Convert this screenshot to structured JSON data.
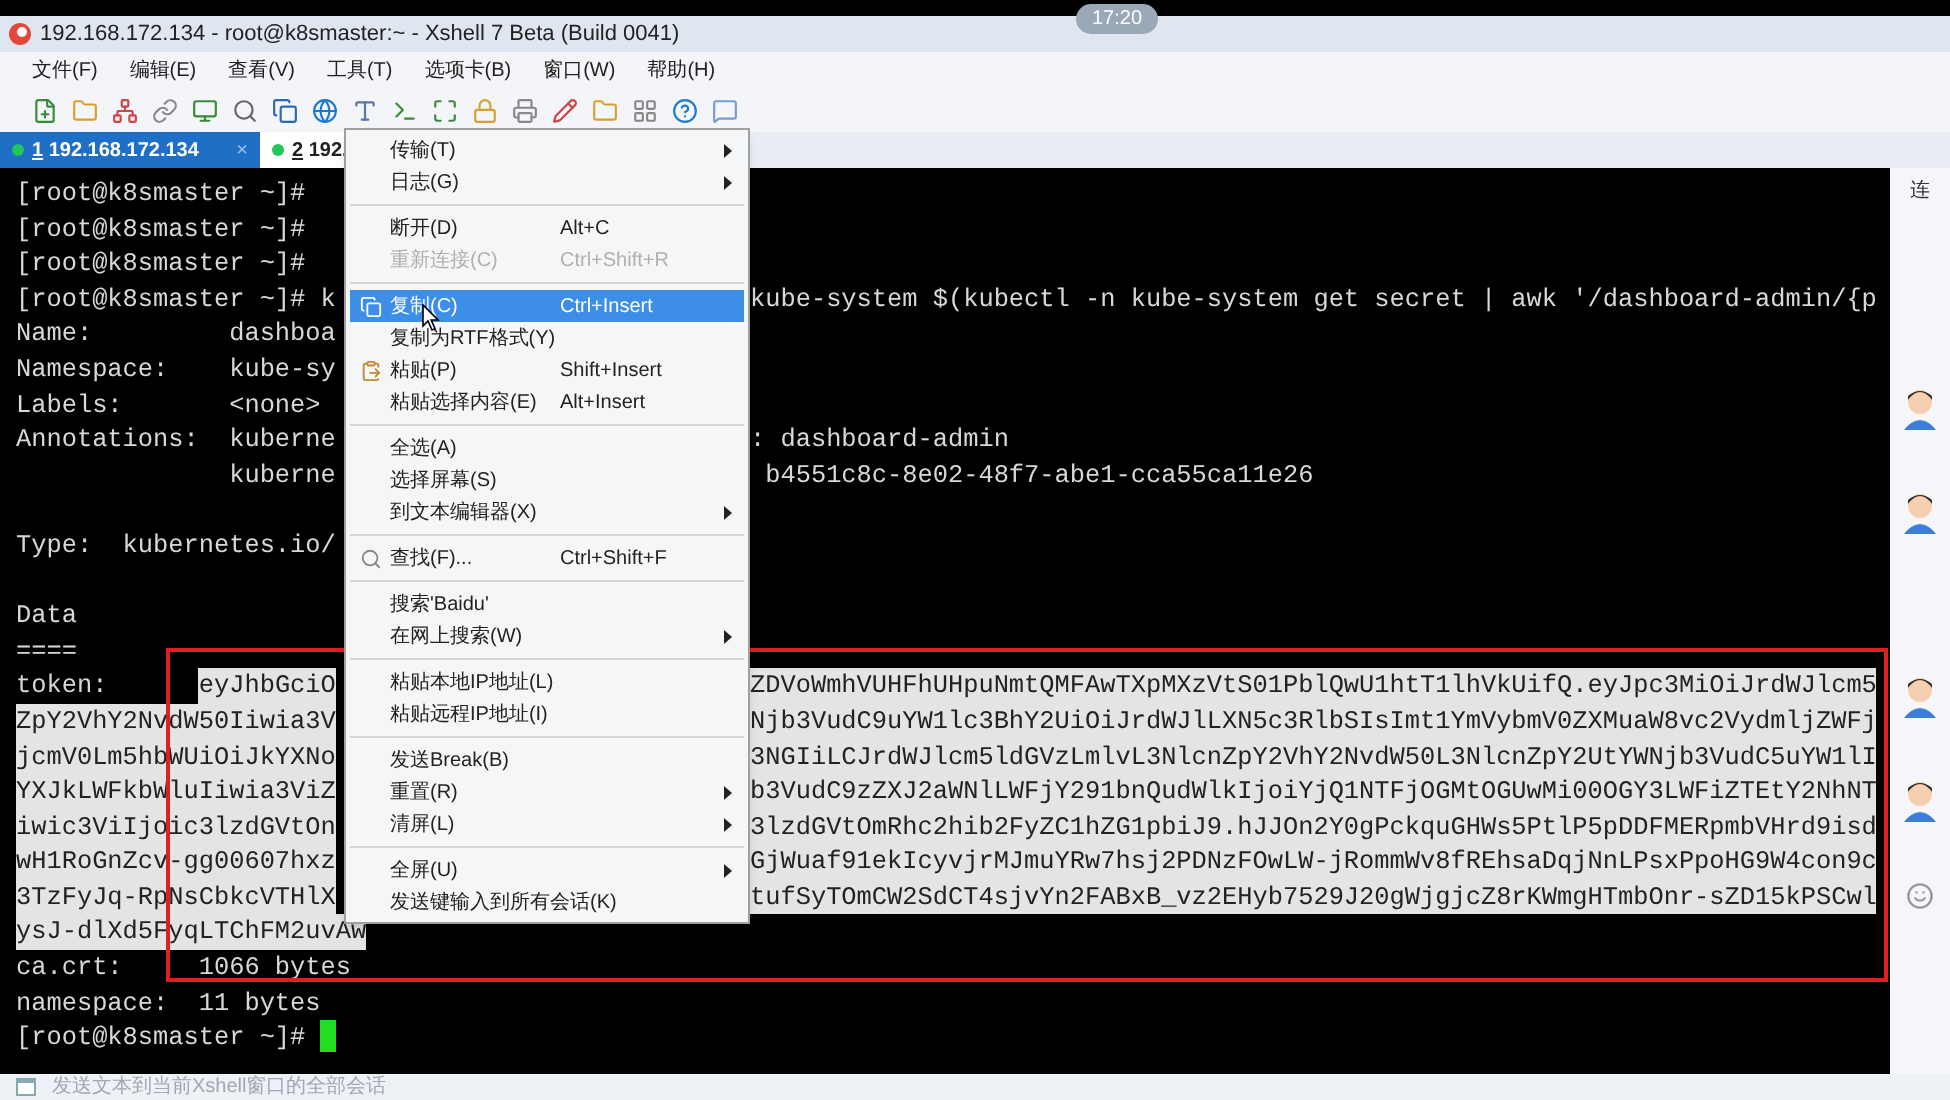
{
  "overlay_time": "17:20",
  "window": {
    "title": "192.168.172.134 - root@k8smaster:~ - Xshell 7 Beta (Build 0041)"
  },
  "menu_bar": [
    "文件(F)",
    "编辑(E)",
    "查看(V)",
    "工具(T)",
    "选项卡(B)",
    "窗口(W)",
    "帮助(H)"
  ],
  "tabs": [
    {
      "number": "1",
      "label": " 192.168.172.134",
      "selected": true,
      "close": "×"
    },
    {
      "number": "2",
      "label": " 192.",
      "selected": false
    }
  ],
  "terminal": {
    "lines": [
      {
        "kind": "text",
        "text": "[root@k8smaster ~]#"
      },
      {
        "kind": "text",
        "text": "[root@k8smaster ~]#"
      },
      {
        "kind": "text",
        "text": "[root@k8smaster ~]#"
      },
      {
        "kind": "text",
        "text": "[root@k8smaster ~]# k",
        "right": "kube-system $(kubectl -n kube-system get secret | awk '/dashboard-admin/{p"
      },
      {
        "kind": "text",
        "text": "Name:         dashboa"
      },
      {
        "kind": "text",
        "text": "Namespace:    kube-sy"
      },
      {
        "kind": "text",
        "text": "Labels:       <none>"
      },
      {
        "kind": "text",
        "text": "Annotations:  kuberne",
        "right": ": dashboard-admin"
      },
      {
        "kind": "text",
        "text": "              kuberne",
        "right": " b4551c8c-8e02-48f7-abe1-cca55ca11e26"
      },
      {
        "kind": "blank"
      },
      {
        "kind": "text",
        "text": "Type:  kubernetes.io/"
      },
      {
        "kind": "blank"
      },
      {
        "kind": "text",
        "text": "Data"
      },
      {
        "kind": "text",
        "text": "===="
      },
      {
        "kind": "text",
        "prefix": "token:      ",
        "text": "eyJhbGciO",
        "right": "ZDVoWmhVUHFhUHpuNmtQMFAwTXpMXzVtS01PblQwU1htT1lhVkUifQ.eyJpc3MiOiJrdWJlcm5",
        "selected": true
      },
      {
        "kind": "text",
        "text": "ZpY2VhY2NvdW50Iiwia3V",
        "right": "Njb3VudC9uYW1lc3BhY2UiOiJrdWJlLXN5c3RlbSIsImt1YmVybmV0ZXMuaW8vc2VydmljZWFj",
        "selected": true
      },
      {
        "kind": "text",
        "text": "jcmV0Lm5hbWUiOiJkYXNo",
        "right": "3NGIiLCJrdWJlcm5ldGVzLmlvL3NlcnZpY2VhY2NvdW50L3NlcnZpY2UtYWNjb3VudC5uYW1lI",
        "selected": true
      },
      {
        "kind": "text",
        "text": "YXJkLWFkbWluIiwia3ViZ",
        "right": "b3VudC9zZXJ2aWNlLWFjY291bnQudWlkIjoiYjQ1NTFjOGMtOGUwMi00OGY3LWFiZTEtY2NhNT",
        "selected": true
      },
      {
        "kind": "text",
        "text": "iwic3ViIjoic3lzdGVtOn",
        "right": "3lzdGVtOmRhc2hib2FyZC1hZG1pbiJ9.hJJOn2Y0gPckquGHWs5PtlP5pDDFMERpmbVHrd9isd",
        "selected": true
      },
      {
        "kind": "text",
        "text": "wH1RoGnZcv-gg00607hxz",
        "right": "GjWuaf91ekIcyvjrMJmuYRw7hsj2PDNzFOwLW-jRommWv8fREhsaDqjNnLPsxPpoHG9W4con9c",
        "selected": true
      },
      {
        "kind": "text",
        "text": "3TzFyJq-RpNsCbkcVTHlX",
        "right": "tufSyTOmCW2SdCT4sjvYn2FABxB_vz2EHyb7529J20gWjgjcZ8rKWmgHTmbOnr-sZD15kPSCwl",
        "selected": true
      },
      {
        "kind": "text",
        "text": "ysJ-dlXd5FyqLTChFM2uvAw",
        "selected": true
      },
      {
        "kind": "text",
        "text": "ca.crt:     1066 bytes"
      },
      {
        "kind": "text",
        "text": "namespace:  11 bytes"
      },
      {
        "kind": "text",
        "text": "[root@k8smaster ~]# ",
        "cursor": true
      }
    ]
  },
  "context_menu": {
    "items": [
      {
        "kind": "item",
        "label": "传输(T)",
        "submenu": true
      },
      {
        "kind": "item",
        "label": "日志(G)",
        "submenu": true
      },
      {
        "kind": "separator"
      },
      {
        "kind": "item",
        "label": "断开(D)",
        "shortcut": "Alt+C"
      },
      {
        "kind": "item",
        "label": "重新连接(C)",
        "shortcut": "Ctrl+Shift+R",
        "disabled": true
      },
      {
        "kind": "separator"
      },
      {
        "kind": "copy",
        "label": "复制(C)",
        "shortcut": "Ctrl+Insert",
        "selected": true
      },
      {
        "kind": "item",
        "label": "复制为RTF格式(Y)"
      },
      {
        "kind": "paste",
        "label": "粘贴(P)",
        "shortcut": "Shift+Insert"
      },
      {
        "kind": "item",
        "label": "粘贴选择内容(E)",
        "shortcut": "Alt+Insert"
      },
      {
        "kind": "separator"
      },
      {
        "kind": "item",
        "label": "全选(A)"
      },
      {
        "kind": "item",
        "label": "选择屏幕(S)"
      },
      {
        "kind": "item",
        "label": "到文本编辑器(X)",
        "submenu": true
      },
      {
        "kind": "separator"
      },
      {
        "kind": "find",
        "label": "查找(F)...",
        "shortcut": "Ctrl+Shift+F"
      },
      {
        "kind": "separator"
      },
      {
        "kind": "item",
        "label": "搜索'Baidu'"
      },
      {
        "kind": "item",
        "label": "在网上搜索(W)",
        "submenu": true
      },
      {
        "kind": "separator"
      },
      {
        "kind": "item",
        "label": "粘贴本地IP地址(L)"
      },
      {
        "kind": "item",
        "label": "粘贴远程IP地址(I)"
      },
      {
        "kind": "separator"
      },
      {
        "kind": "item",
        "label": "发送Break(B)"
      },
      {
        "kind": "item",
        "label": "重置(R)",
        "submenu": true
      },
      {
        "kind": "item",
        "label": "清屏(L)",
        "submenu": true
      },
      {
        "kind": "separator"
      },
      {
        "kind": "item",
        "label": "全屏(U)",
        "submenu": true
      },
      {
        "kind": "item",
        "label": "发送键输入到所有会话(K)"
      }
    ]
  },
  "sidebar": {
    "label": "连"
  },
  "status_bar": "发送文本到当前Xshell窗口的全部会话"
}
